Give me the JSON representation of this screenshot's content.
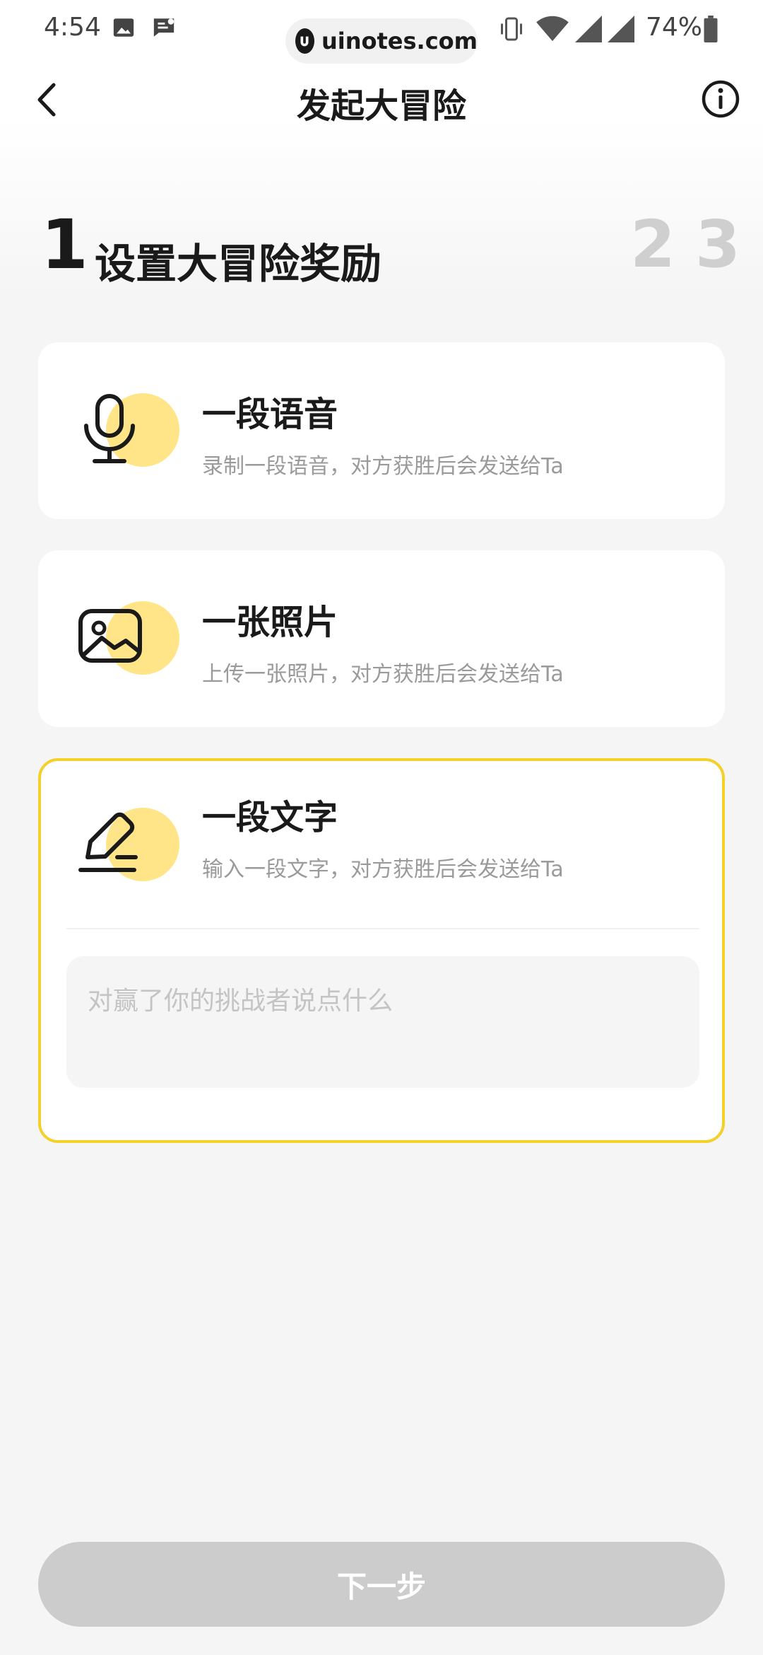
{
  "status_bar": {
    "time": "4:54",
    "battery_percent": "74%",
    "watermark": "uinotes.com",
    "icons": [
      "image-icon",
      "message-icon",
      "vibrate-icon",
      "wifi-icon",
      "signal-icon",
      "signal-icon",
      "battery-icon"
    ]
  },
  "header": {
    "title": "发起大冒险",
    "back_icon": "back-arrow-icon",
    "info_icon": "info-icon"
  },
  "steps": {
    "current_number": "1",
    "current_title": "设置大冒险奖励",
    "next_numbers": [
      "2",
      "3"
    ]
  },
  "options": [
    {
      "title": "一段语音",
      "description": "录制一段语音，对方获胜后会发送给Ta",
      "icon": "microphone-icon",
      "selected": false
    },
    {
      "title": "一张照片",
      "description": "上传一张照片，对方获胜后会发送给Ta",
      "icon": "image-icon",
      "selected": false
    },
    {
      "title": "一段文字",
      "description": "输入一段文字，对方获胜后会发送给Ta",
      "icon": "edit-icon",
      "selected": true
    }
  ],
  "text_input": {
    "placeholder": "对赢了你的挑战者说点什么",
    "value": ""
  },
  "footer": {
    "next_label": "下一步"
  },
  "colors": {
    "accent": "#f4d02b",
    "icon_blob": "#ffe588",
    "button_disabled": "#cccccc",
    "background": "#f5f5f5"
  }
}
